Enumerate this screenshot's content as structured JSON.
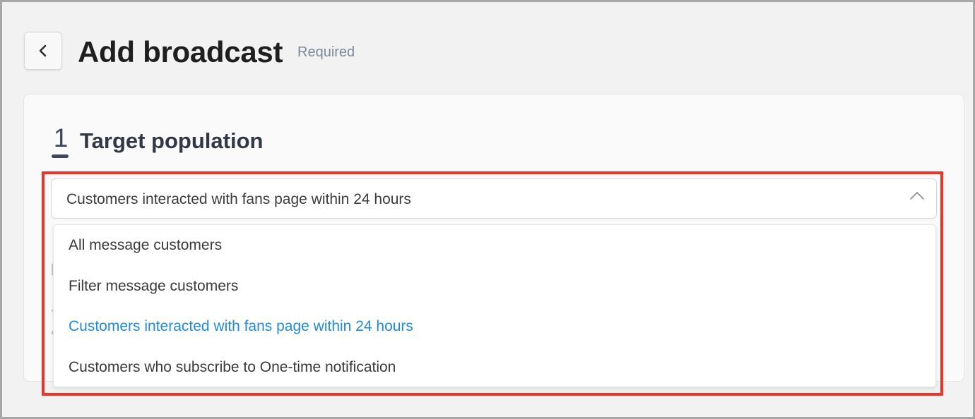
{
  "header": {
    "title": "Add broadcast",
    "required_label": "Required",
    "back_icon": "chevron-left-icon"
  },
  "step": {
    "number": "1",
    "title": "Target population"
  },
  "target_select": {
    "value": "Customers interacted with fans page within 24 hours",
    "expanded": true,
    "toggle_icon": "chevron-up-icon",
    "options": [
      {
        "label": "All message customers",
        "selected": false
      },
      {
        "label": "Filter message customers",
        "selected": false
      },
      {
        "label": "Customers interacted with fans page within 24 hours",
        "selected": true
      },
      {
        "label": "Customers who subscribe to One-time notification",
        "selected": false
      }
    ]
  },
  "colors": {
    "accent": "#1f8ae0",
    "highlight": "#ee3325",
    "background": "#f2f2f2",
    "card": "#fafafa",
    "title": "#1f1f1f",
    "muted": "#7a8899"
  }
}
